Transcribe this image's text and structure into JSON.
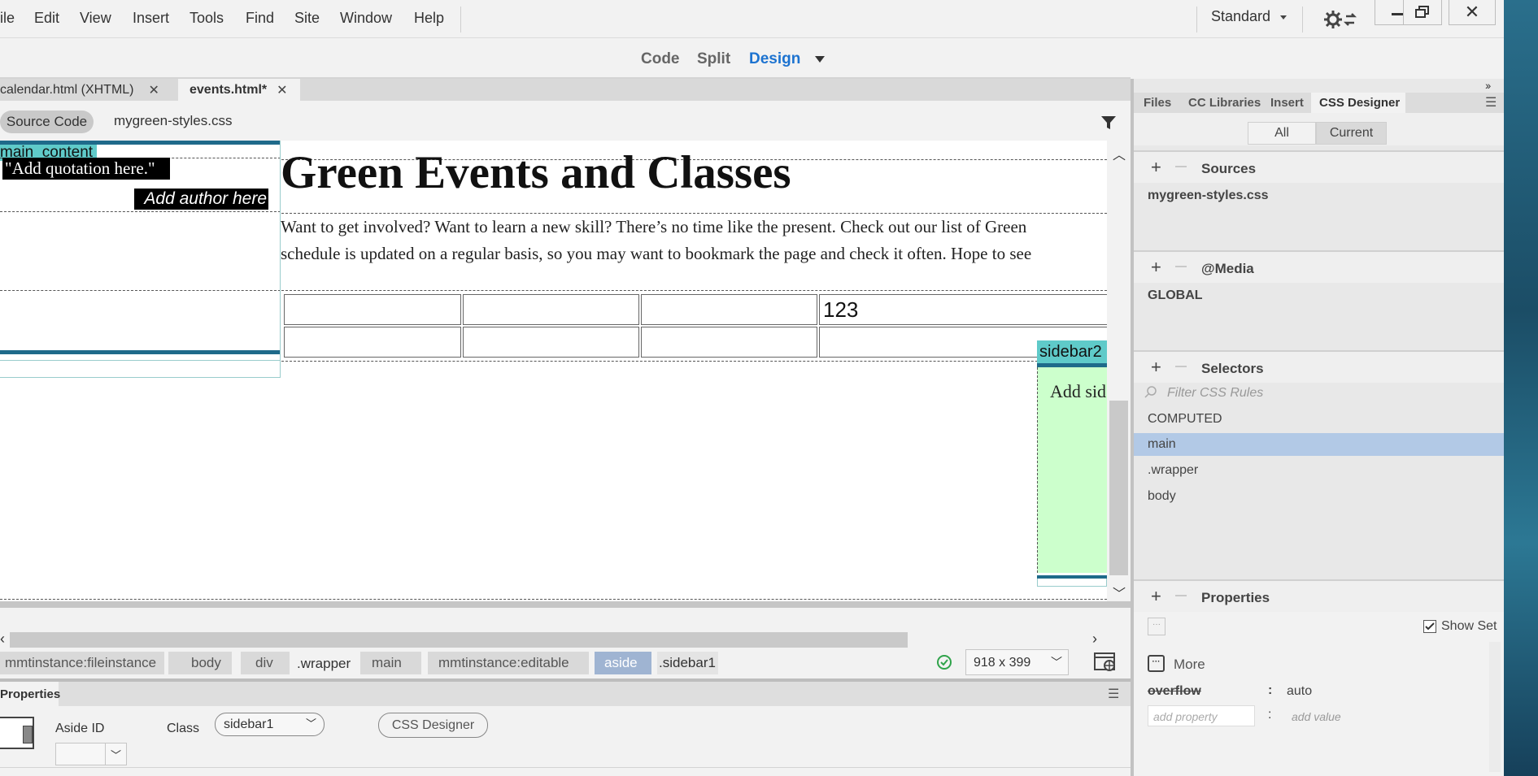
{
  "menubar": {
    "items": [
      "ile",
      "Edit",
      "View",
      "Insert",
      "Tools",
      "Find",
      "Site",
      "Window",
      "Help"
    ],
    "workspace": "Standard",
    "window_controls": [
      "minimize-icon",
      "restore-icon",
      "close-icon"
    ]
  },
  "view_modes": {
    "items": [
      "Code",
      "Split",
      "Design"
    ],
    "active": "Design"
  },
  "doc_tabs": [
    {
      "label": "calendar.html (XHTML)",
      "active": false
    },
    {
      "label": "events.html*",
      "active": true
    }
  ],
  "related_files": {
    "source_code": "Source Code",
    "file": "mygreen-styles.css"
  },
  "canvas": {
    "main_content_label": "main_content",
    "quotation": "\"Add quotation here.\"",
    "author": "Add author here",
    "heading": "Green Events and Classes",
    "intro_line1": "Want to get involved? Want to learn a new skill? There’s no time like the present. Check out our list of Green",
    "intro_line2": "schedule is updated on a regular basis, so you may want to bookmark the page and check it often. Hope to see",
    "table_cell_value": "123",
    "sidebar2_label": "sidebar2",
    "sidebar2_text": "Add sid"
  },
  "tag_selector": {
    "crumbs": [
      "mmtinstance:fileinstance",
      "body",
      "div",
      ".wrapper",
      "main",
      "mmtinstance:editable",
      "aside",
      ".sidebar1"
    ],
    "selected": "aside",
    "window_size": "918 x 399"
  },
  "properties": {
    "tab_label": "Properties",
    "aside_id_label": "Aside ID",
    "class_label": "Class",
    "class_value": "sidebar1",
    "css_designer_button": "CSS Designer"
  },
  "right_panel": {
    "tabs": [
      "Files",
      "CC Libraries",
      "Insert",
      "CSS Designer"
    ],
    "active_tab": "CSS Designer",
    "toggle": [
      "All",
      "Current"
    ],
    "toggle_active": "Current",
    "sources": {
      "title": "Sources",
      "items": [
        "mygreen-styles.css"
      ]
    },
    "media": {
      "title": "@Media",
      "items": [
        "GLOBAL"
      ]
    },
    "selectors": {
      "title": "Selectors",
      "filter_placeholder": "Filter CSS Rules",
      "items": [
        "COMPUTED",
        "main",
        ".wrapper",
        "body"
      ],
      "selected": "main"
    },
    "properties": {
      "title": "Properties",
      "show_set_label": "Show Set",
      "show_set_checked": true,
      "more_label": "More",
      "rows": [
        {
          "name": "overflow",
          "value": "auto"
        }
      ],
      "add_property_placeholder": "add property",
      "add_value_placeholder": "add value"
    }
  },
  "colors": {
    "accent_blue": "#1d73d0",
    "teal_label": "#5fcac9",
    "sidebar_green": "#ccffcc",
    "dark_teal_border": "#1f6a8a",
    "selected_row": "#b2c9e6"
  }
}
